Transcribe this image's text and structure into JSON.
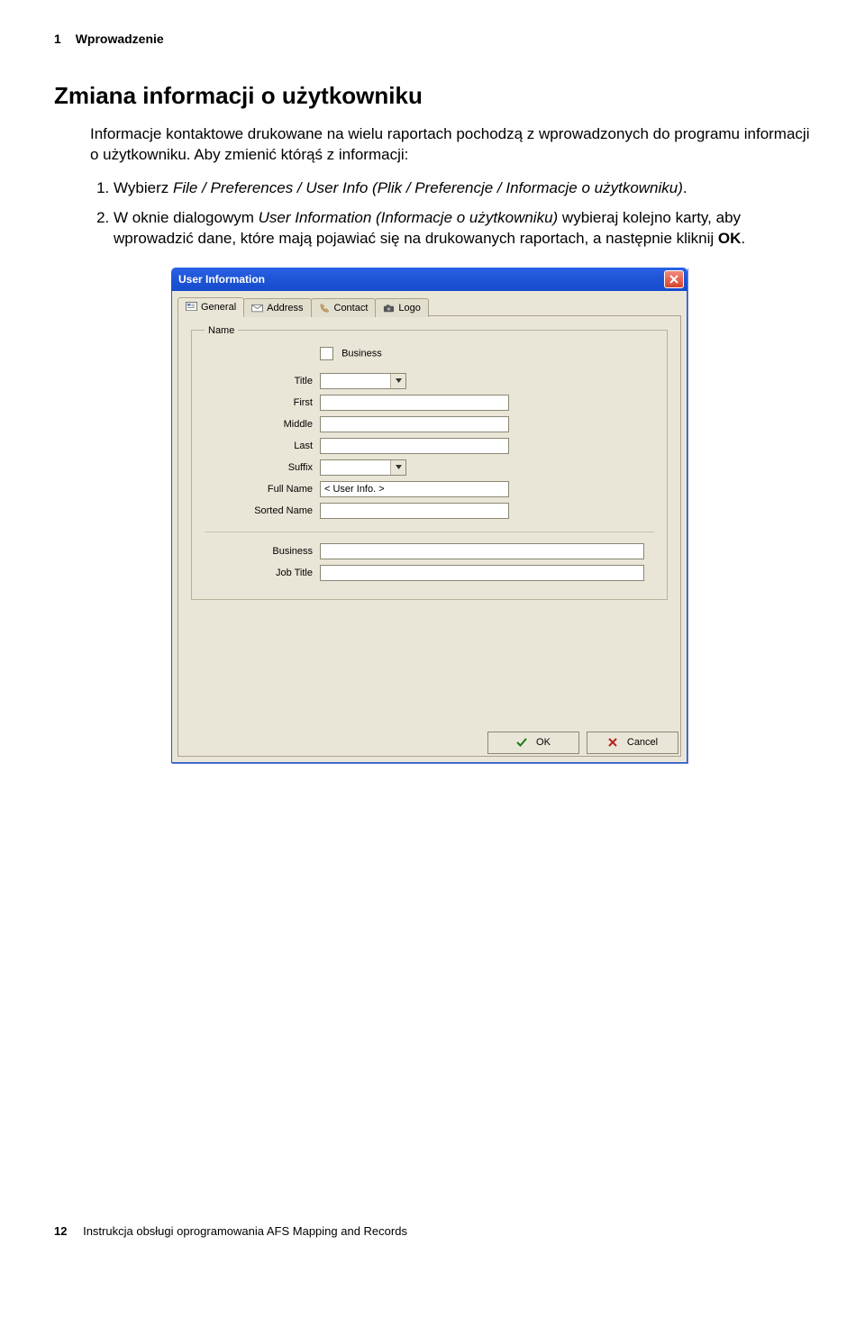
{
  "header": {
    "chapter_num": "1",
    "chapter_title": "Wprowadzenie"
  },
  "section": {
    "title": "Zmiana informacji o użytkowniku",
    "intro": "Informacje kontaktowe drukowane na wielu raportach pochodzą z wprowadzonych do programu informacji o użytkowniku. Aby zmienić którąś z informacji:",
    "steps": [
      {
        "pre": "Wybierz ",
        "em": "File / Preferences / User Info (Plik / Preferencje / Informacje o użytkowniku)",
        "post": "."
      },
      {
        "pre": "W oknie dialogowym ",
        "em": "User Information (Informacje o użytkowniku)",
        "post": " wybieraj kolejno karty, aby wprowadzić dane, które mają pojawiać się na drukowanych raportach, a następnie kliknij ",
        "ok": "OK",
        "end": "."
      }
    ]
  },
  "dialog": {
    "title": "User Information",
    "tabs": [
      {
        "label": "General"
      },
      {
        "label": "Address"
      },
      {
        "label": "Contact"
      },
      {
        "label": "Logo"
      }
    ],
    "group": {
      "legend": "Name"
    },
    "fields": {
      "business_check": "Business",
      "title_lbl": "Title",
      "first_lbl": "First",
      "middle_lbl": "Middle",
      "last_lbl": "Last",
      "suffix_lbl": "Suffix",
      "fullname_lbl": "Full Name",
      "fullname_val": "< User Info. >",
      "sortedname_lbl": "Sorted Name",
      "business_lbl": "Business",
      "jobtitle_lbl": "Job Title"
    },
    "buttons": {
      "ok": "OK",
      "cancel": "Cancel"
    }
  },
  "footer": {
    "page": "12",
    "doc": "Instrukcja obsługi oprogramowania AFS Mapping and Records"
  }
}
